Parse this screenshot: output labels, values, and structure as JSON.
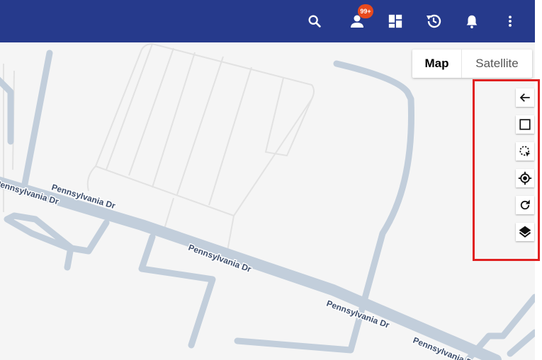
{
  "header": {
    "background": "#263a8c",
    "notification_badge": "99+",
    "icons": [
      "search-icon",
      "user-icon",
      "dashboard-icon",
      "history-icon",
      "bell-icon",
      "more-vert-icon"
    ]
  },
  "map_type": {
    "map_label": "Map",
    "satellite_label": "Satellite",
    "selected": "Map"
  },
  "map": {
    "road_labels": [
      "Pennsylvania Dr",
      "Pennsylvania Dr",
      "Pennsylvania Dr",
      "Pennsylvania Dr",
      "Pennsylvania Dr",
      "Pennsylvania Dr"
    ]
  },
  "toolbar": {
    "highlight_color": "#e02020",
    "tools": [
      "back-arrow-icon",
      "square-draw-icon",
      "lasso-select-icon",
      "my-location-icon",
      "refresh-icon",
      "layers-icon"
    ]
  }
}
